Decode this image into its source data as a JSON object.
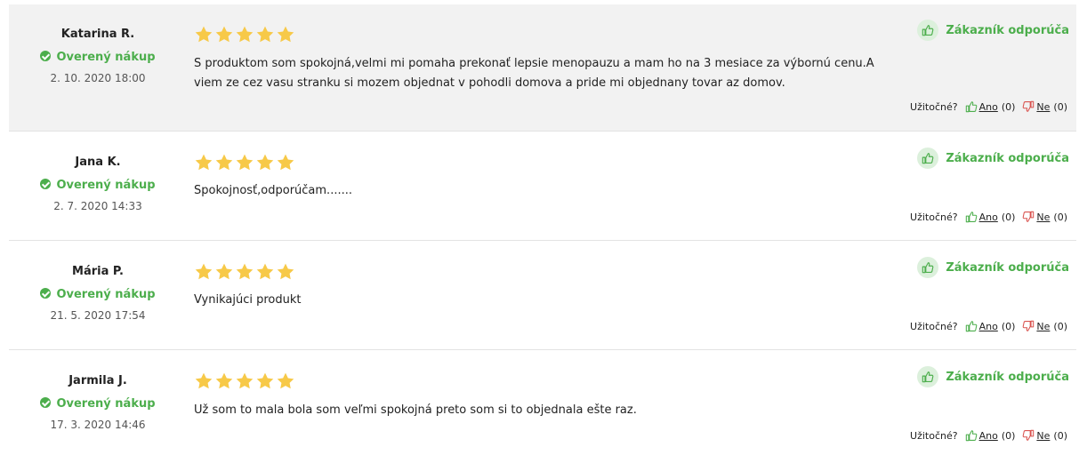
{
  "ui": {
    "verified_label": "Overený nákup",
    "recommend_label": "Zákazník odporúča",
    "helpful_label": "Užitočné?",
    "yes_label": "Ano",
    "no_label": "Ne"
  },
  "colors": {
    "green": "#4cae4c",
    "star": "#f7c948",
    "red": "#d9534f",
    "highlight_bg": "#f2f2f2"
  },
  "reviews": [
    {
      "author": "Katarina R.",
      "date": "2. 10. 2020 18:00",
      "rating": 5,
      "text": "S produktom som spokojná,velmi mi pomaha prekonať lepsie menopauzu a mam ho na 3 mesiace za výbornú cenu.A viem ze cez vasu stranku si mozem objednat v pohodli domova a pride mi objednany tovar az domov.",
      "yes_count": "(0)",
      "no_count": "(0)"
    },
    {
      "author": "Jana K.",
      "date": "2. 7. 2020 14:33",
      "rating": 5,
      "text": "Spokojnosť,odporúčam.......",
      "yes_count": "(0)",
      "no_count": "(0)"
    },
    {
      "author": "Mária P.",
      "date": "21. 5. 2020 17:54",
      "rating": 5,
      "text": "Vynikajúci produkt",
      "yes_count": "(0)",
      "no_count": "(0)"
    },
    {
      "author": "Jarmila J.",
      "date": "17. 3. 2020 14:46",
      "rating": 5,
      "text": "Už som to mala bola som veľmi spokojná preto som si to objednala ešte raz.",
      "yes_count": "(0)",
      "no_count": "(0)"
    }
  ]
}
